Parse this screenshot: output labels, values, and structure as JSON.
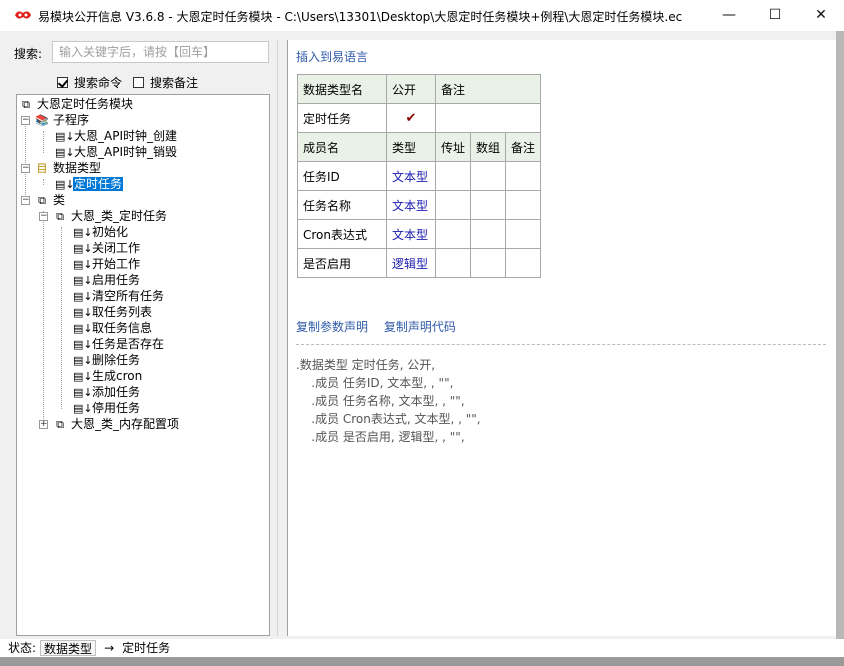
{
  "window": {
    "title": "易模块公开信息 V3.6.8 - 大恩定时任务模块 - C:\\Users\\13301\\Desktop\\大恩定时任务模块+例程\\大恩定时任务模块.ec",
    "minimize": "—",
    "maximize": "☐",
    "close": "✕"
  },
  "search": {
    "label": "搜索:",
    "placeholder": "输入关键字后，请按【回车】",
    "value": "",
    "options": [
      {
        "label": "搜索命令",
        "checked": true
      },
      {
        "label": "搜索备注",
        "checked": false
      }
    ]
  },
  "tree": {
    "root": "大恩定时任务模块",
    "subprograms": {
      "label": "子程序",
      "items": [
        "大恩_API时钟_创建",
        "大恩_API时钟_销毁"
      ]
    },
    "datatypes": {
      "label": "数据类型",
      "items": [
        "定时任务"
      ]
    },
    "classes": {
      "label": "类",
      "class1": {
        "label": "大恩_类_定时任务",
        "methods": [
          "初始化",
          "关闭工作",
          "开始工作",
          "启用任务",
          "清空所有任务",
          "取任务列表",
          "取任务信息",
          "任务是否存在",
          "删除任务",
          "生成cron",
          "添加任务",
          "停用任务"
        ]
      },
      "class2": {
        "label": "大恩_类_内存配置项"
      }
    }
  },
  "detail": {
    "insert_link": "插入到易语言",
    "header": {
      "col1": "数据类型名",
      "col2": "公开",
      "col3": "备注"
    },
    "type_row": {
      "name": "定时任务",
      "public": "✔",
      "note": ""
    },
    "member_header": {
      "name": "成员名",
      "type": "类型",
      "byref": "传址",
      "array": "数组",
      "note": "备注"
    },
    "members": [
      {
        "name": "任务ID",
        "type": "文本型"
      },
      {
        "name": "任务名称",
        "type": "文本型"
      },
      {
        "name": "Cron表达式",
        "type": "文本型"
      },
      {
        "name": "是否启用",
        "type": "逻辑型"
      }
    ],
    "copy_params": "复制参数声明",
    "copy_code": "复制声明代码",
    "code_lines": [
      ".数据类型 定时任务, 公开,",
      "    .成员 任务ID, 文本型, , \"\",",
      "    .成员 任务名称, 文本型, , \"\",",
      "    .成员 Cron表达式, 文本型, , \"\",",
      "    .成员 是否启用, 逻辑型, , \"\","
    ]
  },
  "status": {
    "label": "状态:",
    "value": "数据类型",
    "arrow": "→",
    "target": "定时任务"
  },
  "colors": {
    "selection": "#0078d7",
    "link": "#2f5aa8",
    "type_text": "#1a1ab0",
    "header_bg": "#eaf2e7"
  }
}
